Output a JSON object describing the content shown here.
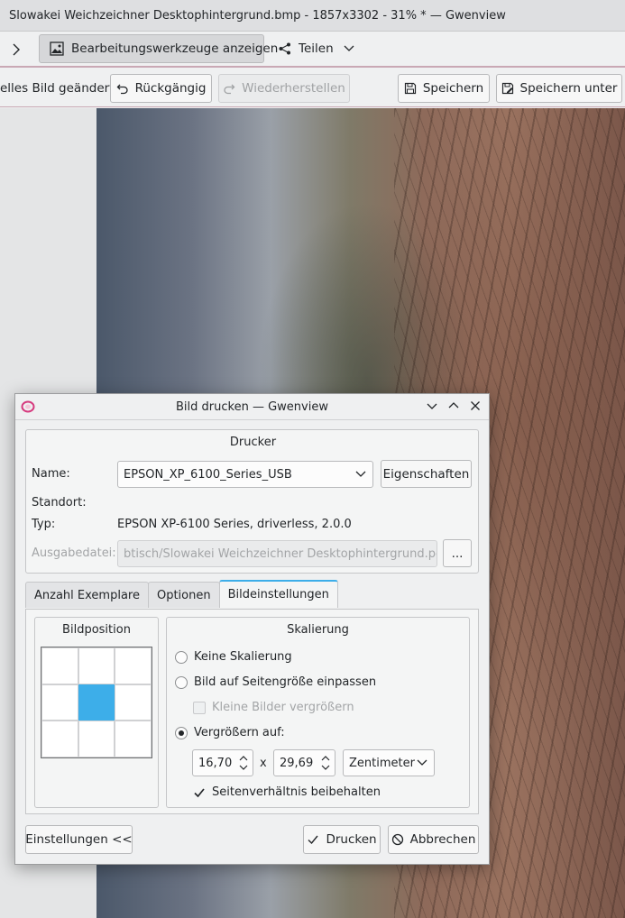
{
  "window": {
    "title": "Slowakei Weichzeichner Desktophintergrund.bmp - 1857x3302 - 31% * — Gwenview"
  },
  "toolbar": {
    "edit_tools_label": "Bearbeitungswerkzeuge anzeigen",
    "share_label": "Teilen"
  },
  "editbar": {
    "status_label": "elles Bild geändert",
    "undo_label": "Rückgängig",
    "redo_label": "Wiederherstellen",
    "save_label": "Speichern",
    "save_as_label": "Speichern unter"
  },
  "dialog": {
    "title": "Bild drucken — Gwenview",
    "printer_group": "Drucker",
    "name_label": "Name:",
    "name_value": "EPSON_XP_6100_Series_USB",
    "properties_label": "Eigenschaften",
    "location_label": "Standort:",
    "location_value": "",
    "type_label": "Typ:",
    "type_value": "EPSON XP-6100 Series, driverless, 2.0.0",
    "output_label": "Ausgabedatei:",
    "output_value": "btisch/Slowakei Weichzeichner Desktophintergrund.pdf",
    "browse_label": "...",
    "tabs": [
      {
        "label": "Anzahl Exemplare",
        "active": false
      },
      {
        "label": "Optionen",
        "active": false
      },
      {
        "label": "Bildeinstellungen",
        "active": true
      }
    ],
    "position_group": "Bildposition",
    "position_selected": "center",
    "scaling_group": "Skalierung",
    "scaling": {
      "no_scaling_label": "Keine Skalierung",
      "fit_page_label": "Bild auf Seitengröße einpassen",
      "enlarge_small_label": "Kleine Bilder vergrößern",
      "scale_to_label": "Vergrößern auf:",
      "selected": "scale_to",
      "width_value": "16,70",
      "times_label": "x",
      "height_value": "29,69",
      "unit_value": "Zentimeter",
      "keep_ratio_label": "Seitenverhältnis beibehalten",
      "keep_ratio_checked": true
    },
    "settings_toggle_label": "Einstellungen <<",
    "print_label": "Drucken",
    "cancel_label": "Abbrechen"
  },
  "colors": {
    "accent": "#3daee9",
    "window_bg": "#eff0f1",
    "toolbar_border": "#c9a8b4",
    "app_icon": "#d63a7e"
  }
}
